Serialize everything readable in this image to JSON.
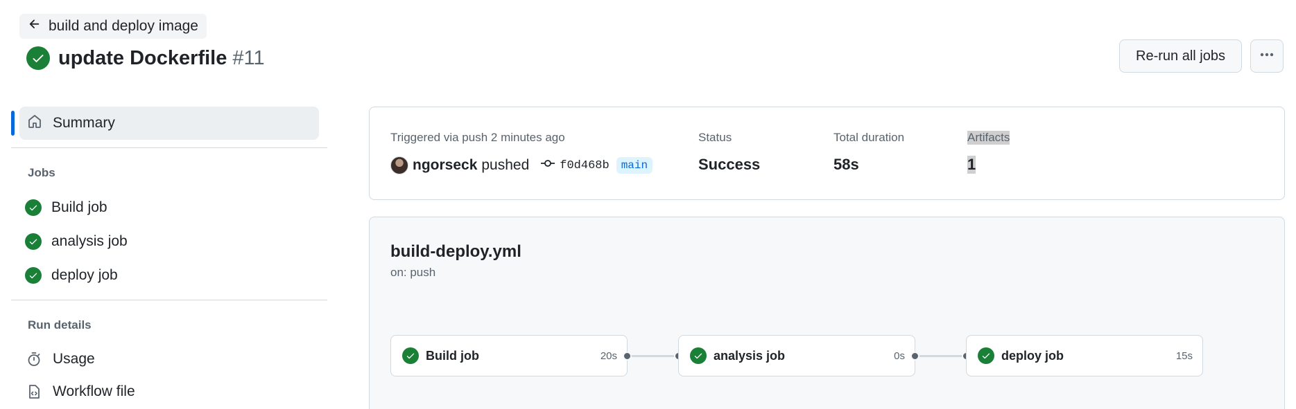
{
  "header": {
    "back_label": "build and deploy image",
    "run_title": "update Dockerfile",
    "run_number": "#11",
    "rerun_label": "Re-run all jobs"
  },
  "sidebar": {
    "summary_label": "Summary",
    "jobs_heading": "Jobs",
    "jobs": [
      {
        "label": "Build job",
        "status": "success"
      },
      {
        "label": "analysis job",
        "status": "success"
      },
      {
        "label": "deploy job",
        "status": "success"
      }
    ],
    "run_details_heading": "Run details",
    "details": [
      {
        "label": "Usage",
        "icon": "stopwatch-icon"
      },
      {
        "label": "Workflow file",
        "icon": "file-code-icon"
      }
    ]
  },
  "summary": {
    "trigger_text": "Triggered via push 2 minutes ago",
    "actor": "ngorseck",
    "action": "pushed",
    "commit_sha": "f0d468b",
    "branch": "main",
    "status_label": "Status",
    "status_value": "Success",
    "duration_label": "Total duration",
    "duration_value": "58s",
    "artifacts_label": "Artifacts",
    "artifacts_value": "1"
  },
  "workflow": {
    "file_name": "build-deploy.yml",
    "trigger": "on: push",
    "jobs": [
      {
        "name": "Build job",
        "duration": "20s"
      },
      {
        "name": "analysis job",
        "duration": "0s"
      },
      {
        "name": "deploy job",
        "duration": "15s"
      }
    ]
  },
  "colors": {
    "success": "#1a7f37",
    "accent": "#0969da",
    "border": "#d1d9e0",
    "muted_text": "#59636e"
  }
}
